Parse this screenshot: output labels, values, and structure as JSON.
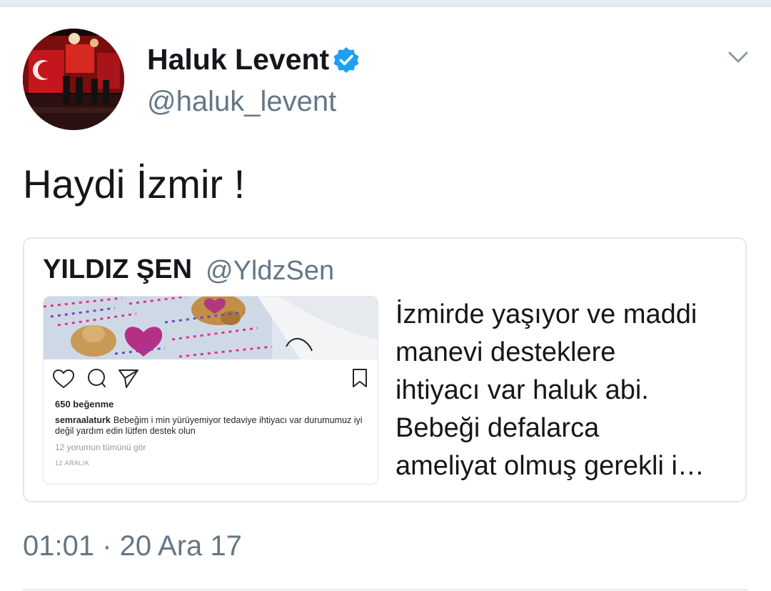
{
  "tweet": {
    "author": {
      "display_name": "Haluk Levent",
      "handle": "@haluk_levent",
      "verified": true
    },
    "text": "Haydi İzmir !",
    "timestamp": "01:01 · 20 Ara 17"
  },
  "quoted_tweet": {
    "display_name": "YILDIZ ŞEN",
    "handle": "@YldzSen",
    "text_lines": [
      "İzmirde yaşıyor ve maddi",
      "manevi desteklere",
      "ihtiyacı var haluk abi.",
      "Bebeği defalarca",
      "ameliyat olmuş gerekli i…"
    ],
    "media": {
      "likes": "650 beğenme",
      "username": "semraalaturk",
      "caption": "Bebeğim i min yürüyemiyor tedaviye ihtiyacı var durumumuz iyi değil yardım edin lütfen destek olun",
      "comments": "12 yorumun tümünü gör",
      "date": "12 ARALIK"
    }
  },
  "colors": {
    "text_primary": "#14171a",
    "text_secondary": "#657786",
    "border": "#e1e8ed",
    "verified_blue": "#1da1f2"
  },
  "icons": {
    "verified": "verified-badge-icon",
    "chevron": "chevron-down-icon",
    "media_heart": "heart-icon",
    "media_comment": "comment-icon",
    "media_share": "share-icon",
    "media_bookmark": "bookmark-icon"
  }
}
